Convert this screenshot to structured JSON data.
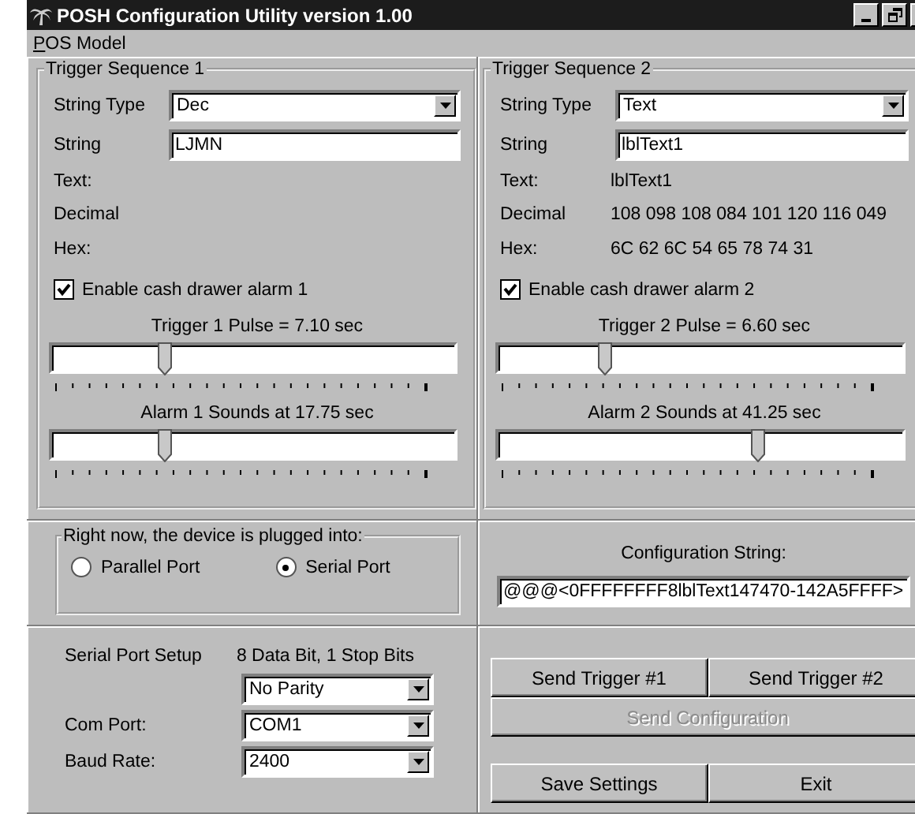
{
  "window": {
    "title": "POSH Configuration Utility version 1.00"
  },
  "menu": [
    {
      "label": "POS Model"
    }
  ],
  "triggers": [
    {
      "title": "Trigger Sequence 1",
      "string_type_label": "String Type",
      "string_type": "Dec",
      "string_label": "String",
      "string": "LJMN",
      "text_label": "Text:",
      "decimal_label": "Decimal",
      "hex_label": "Hex:",
      "alarm": {
        "label": "Enable cash drawer alarm 1",
        "checked": true
      },
      "sliders": [
        {
          "label": "Trigger 1 Pulse = 7.10 sec",
          "level": 0.28
        },
        {
          "label": "Alarm 1 Sounds at 17.75 sec",
          "level": 0.28
        }
      ]
    },
    {
      "title": "Trigger Sequence 2",
      "string_type_label": "String Type",
      "string_type": "Text",
      "string_label": "String",
      "string": "lblText1",
      "text_label": "Text:",
      "text_value": "lblText1",
      "decimal_label": "Decimal",
      "decimal_value": "108 098 108 084 101 120 116 049",
      "hex_label": "Hex:",
      "hex_value": "6C 62 6C 54 65 78 74 31",
      "alarm": {
        "label": "Enable cash drawer alarm 2",
        "checked": true
      },
      "sliders": [
        {
          "label": "Trigger 2 Pulse = 6.60 sec",
          "level": 0.26
        },
        {
          "label": "Alarm 2 Sounds at 41.25 sec",
          "level": 0.64
        }
      ]
    }
  ],
  "port": {
    "title": "Right now, the device is plugged into:",
    "options": [
      {
        "label": "Parallel Port",
        "selected": false
      },
      {
        "label": "Serial Port",
        "selected": true
      }
    ]
  },
  "config": {
    "label": "Configuration String:",
    "value": "@@@<0FFFFFFFF8lblText147470-142A5FFFF>"
  },
  "serial": {
    "title": "Serial Port Setup",
    "info": "8 Data Bit,  1 Stop Bits",
    "fields": [
      {
        "value": "No Parity"
      },
      {
        "label": "Com Port:",
        "value": "COM1"
      },
      {
        "label": "Baud Rate:",
        "value": "2400"
      }
    ]
  },
  "send_buttons": [
    [
      {
        "label": "Send Trigger #1",
        "disabled": false
      },
      {
        "label": "Send Trigger #2",
        "disabled": false
      }
    ],
    [
      {
        "label": "Send Configuration",
        "disabled": true
      }
    ]
  ],
  "bottom_buttons": [
    {
      "label": "Save Settings",
      "disabled": false
    },
    {
      "label": "Exit",
      "disabled": false
    }
  ]
}
